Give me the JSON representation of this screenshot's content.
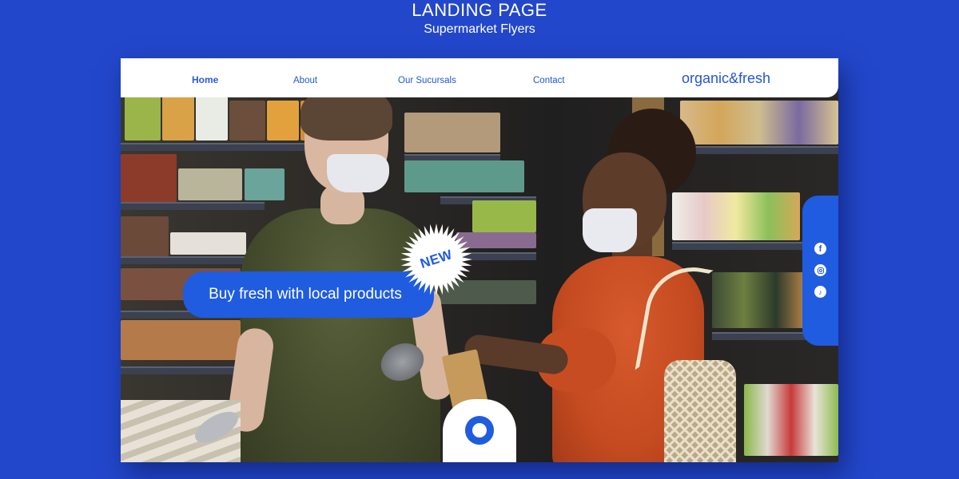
{
  "heading": {
    "title": "LANDING PAGE",
    "subtitle": "Supermarket Flyers"
  },
  "nav": {
    "links": [
      {
        "label": "Home",
        "active": true
      },
      {
        "label": "About",
        "active": false
      },
      {
        "label": "Our Sucursals",
        "active": false
      },
      {
        "label": "Contact",
        "active": false
      }
    ],
    "logo": "organic&fresh"
  },
  "hero": {
    "cta_label": "Buy fresh with local products",
    "badge": "NEW",
    "image_description": "Two shoppers wearing face masks in a supermarket aisle"
  },
  "social": {
    "icons": [
      {
        "name": "facebook-icon",
        "glyph": "f"
      },
      {
        "name": "instagram-icon",
        "glyph": ""
      },
      {
        "name": "tiktok-icon",
        "glyph": "♪"
      }
    ]
  },
  "colors": {
    "background": "#2347CB",
    "accent": "#1F5CE0",
    "nav_text": "#2456D6",
    "white": "#FFFFFF"
  }
}
